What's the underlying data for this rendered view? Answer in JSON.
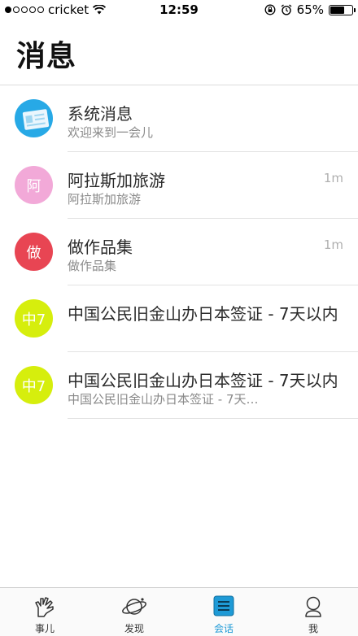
{
  "status_bar": {
    "carrier": "cricket",
    "time": "12:59",
    "battery_percent": "65%",
    "battery_level": 0.65
  },
  "header": {
    "title": "消息"
  },
  "conversations": [
    {
      "title": "系统消息",
      "subtitle": "欢迎来到一会儿",
      "time": "",
      "avatar_text": "",
      "avatar_color": "#27a9e6",
      "icon": "id-card-icon"
    },
    {
      "title": "阿拉斯加旅游",
      "subtitle": "阿拉斯加旅游",
      "time": "1m",
      "avatar_text": "阿",
      "avatar_color": "#f2a9d8"
    },
    {
      "title": "做作品集",
      "subtitle": "做作品集",
      "time": "1m",
      "avatar_text": "做",
      "avatar_color": "#e84553"
    },
    {
      "title": "中国公民旧金山办日本签证 - 7天以内",
      "subtitle": "",
      "time": "",
      "avatar_text": "中7",
      "avatar_color": "#d6ee0d"
    },
    {
      "title": "中国公民旧金山办日本签证 - 7天以内",
      "subtitle": "中国公民旧金山办日本签证 - 7天…",
      "time": "",
      "avatar_text": "中7",
      "avatar_color": "#d6ee0d"
    }
  ],
  "tabbar": {
    "tabs": [
      {
        "label": "事儿",
        "icon": "hand-icon",
        "active": false
      },
      {
        "label": "发现",
        "icon": "planet-icon",
        "active": false
      },
      {
        "label": "会话",
        "icon": "list-icon",
        "active": true
      },
      {
        "label": "我",
        "icon": "person-icon",
        "active": false
      }
    ]
  },
  "colors": {
    "accent": "#1e9ad6",
    "separator": "#e2e2e2"
  }
}
